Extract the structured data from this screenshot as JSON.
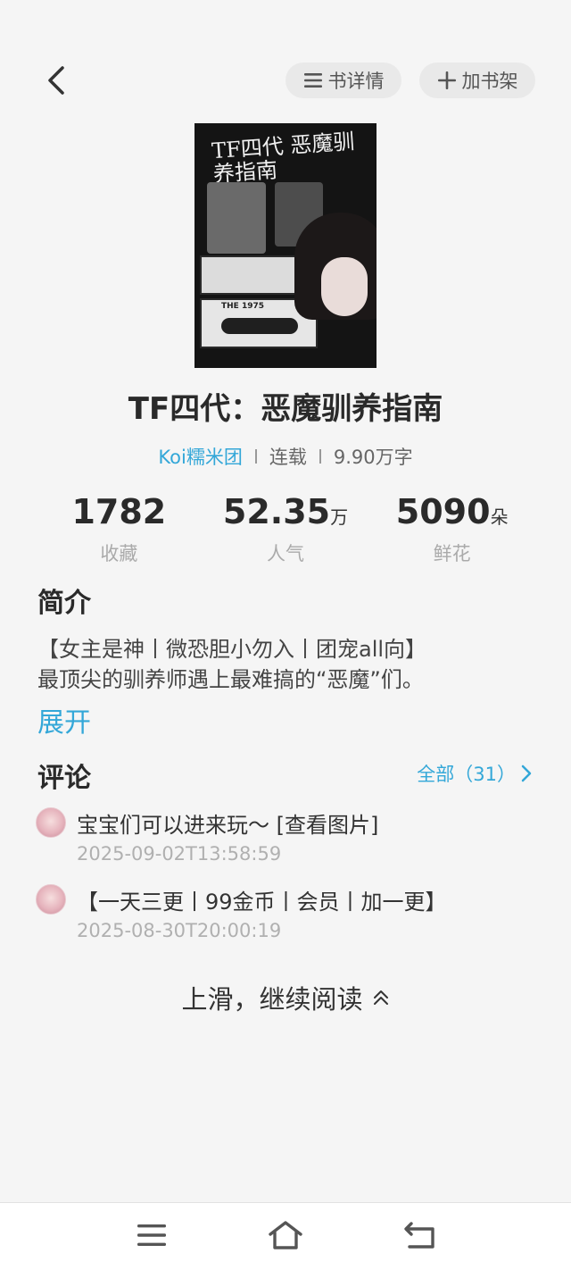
{
  "header": {
    "detail_label": "书详情",
    "shelf_label": "加书架",
    "icons": {
      "back": "chevron-left-icon",
      "detail": "list-icon",
      "shelf": "plus-icon"
    }
  },
  "cover": {
    "title_art": "TF四代 恶魔驯养指南",
    "tape_label": "THE 1975"
  },
  "book": {
    "title": "TF四代：恶魔驯养指南",
    "author": "Koi糯米团",
    "status": "连载",
    "word_count": "9.90万字"
  },
  "stats": [
    {
      "value": "1782",
      "unit": "",
      "label": "收藏"
    },
    {
      "value": "52.35",
      "unit": "万",
      "label": "人气"
    },
    {
      "value": "5090",
      "unit": "朵",
      "label": "鲜花"
    }
  ],
  "intro": {
    "title": "简介",
    "lines": [
      "【女主是神丨微恐胆小勿入丨团宠all向】",
      "最顶尖的驯养师遇上最难搞的“恶魔”们。"
    ],
    "expand_label": "展开"
  },
  "comments": {
    "title": "评论",
    "see_all_label": "全部（31）",
    "items": [
      {
        "text": "宝宝们可以进来玩～  [查看图片]",
        "time": "2025-09-02T13:58:59"
      },
      {
        "text": "【一天三更丨99金币丨会员丨加一更】",
        "time": "2025-08-30T20:00:19"
      }
    ]
  },
  "continue_label": "上滑，继续阅读",
  "colors": {
    "accent": "#33a7d8",
    "background": "#f5f5f5",
    "pill_bg": "#e9e9e9",
    "muted_text": "#b0b0b0"
  },
  "nav_icons": [
    "menu-icon",
    "home-icon",
    "back-icon"
  ]
}
